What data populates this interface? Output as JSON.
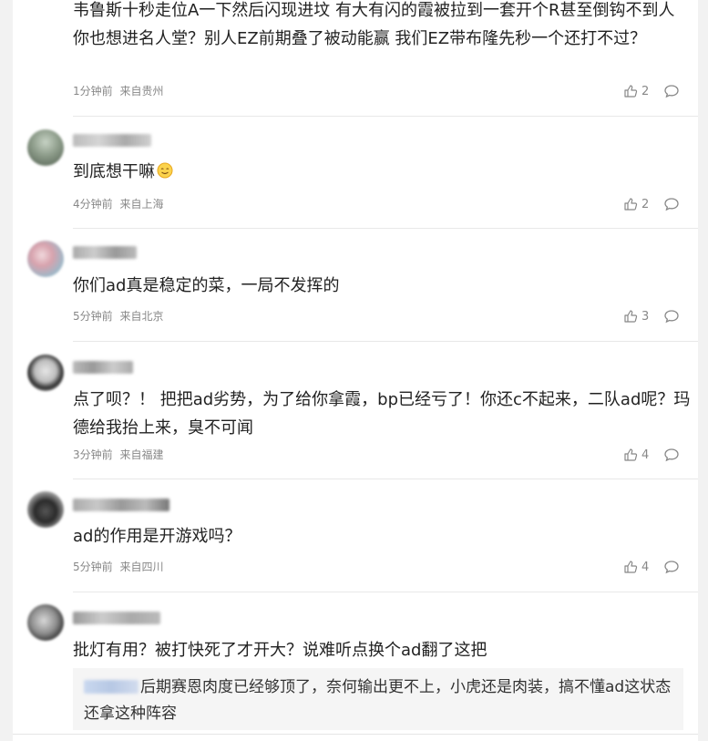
{
  "comments": [
    {
      "text": "韦鲁斯十秒走位A一下然后闪现进坟 有大有闪的霞被拉到一套开个R甚至倒钩不到人 你也想进名人堂？别人EZ前期叠了被动能赢 我们EZ带布隆先秒一个还打不过？",
      "time": "1分钟前",
      "location": "来自贵州",
      "likes": "2"
    },
    {
      "text": "到底想干嘛",
      "time": "4分钟前",
      "location": "来自上海",
      "likes": "2"
    },
    {
      "text": "你们ad真是稳定的菜，一局不发挥的",
      "time": "5分钟前",
      "location": "来自北京",
      "likes": "3"
    },
    {
      "text": "点了呗？！ 把把ad劣势，为了给你拿霞，bp已经亏了！你还c不起来，二队ad呢？玛德给我抬上来，臭不可闻",
      "time": "3分钟前",
      "location": "来自福建",
      "likes": "4"
    },
    {
      "text": "ad的作用是开游戏吗？",
      "time": "5分钟前",
      "location": "来自四川",
      "likes": "4"
    },
    {
      "text": "批灯有用？被打快死了才开大？说难听点换个ad翻了这把",
      "reply_quote": "后期赛恩肉度已经够顶了，奈何输出更不上，小虎还是肉装，搞不懂ad这状态还拿这种阵容"
    }
  ],
  "icons": {
    "like": "thumbs-up-icon",
    "reply": "comment-bubble-icon",
    "emoji": "smile-emoji-icon"
  },
  "colors": {
    "meta_text": "#888888",
    "body_text": "#222222",
    "divider": "#e8e8e8",
    "quote_bg": "#f5f5f5"
  }
}
